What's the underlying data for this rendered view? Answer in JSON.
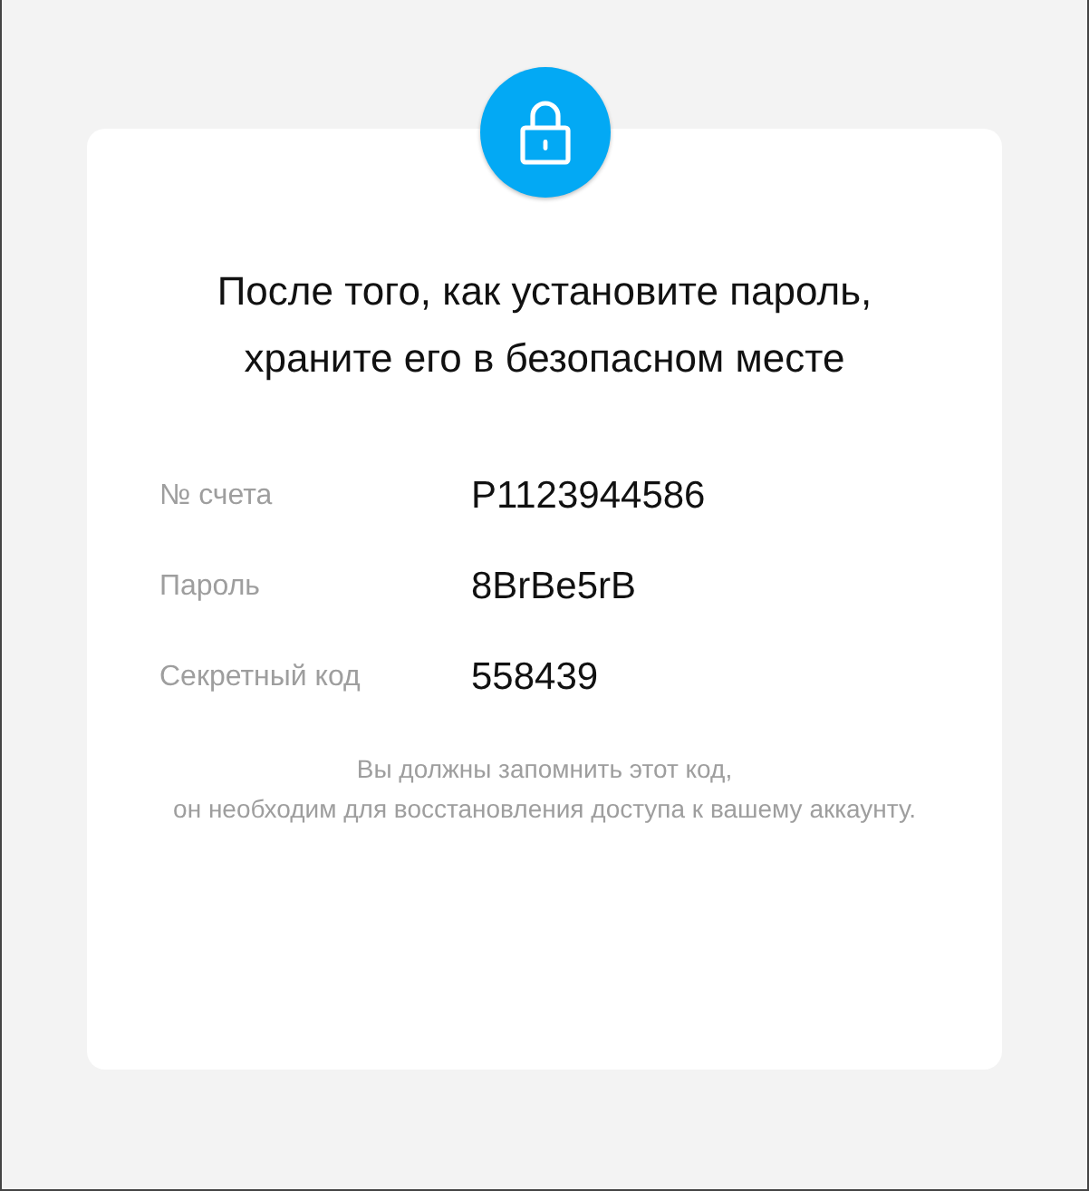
{
  "card": {
    "heading": [
      "После того, как установите пароль,",
      "храните его в безопасном месте"
    ],
    "rows": [
      {
        "label": "№ счета",
        "value": "P1123944586"
      },
      {
        "label": "Пароль",
        "value": "8BrBe5rB"
      },
      {
        "label": "Секретный код",
        "value": "558439"
      }
    ],
    "note": [
      "Вы должны запомнить этот код,",
      "он необходим для восстановления доступа к вашему аккаунту."
    ]
  }
}
